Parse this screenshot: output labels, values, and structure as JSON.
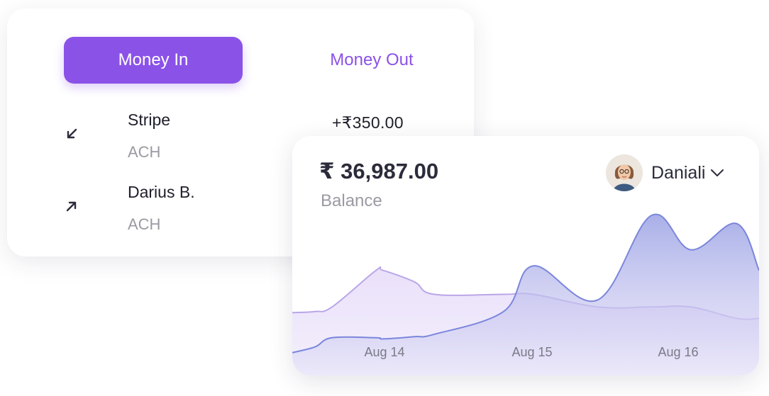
{
  "tabs": {
    "money_in": "Money In",
    "money_out": "Money Out"
  },
  "transactions": [
    {
      "name": "Stripe",
      "method": "ACH",
      "amount": "+₹350.00",
      "direction": "incoming",
      "icon": "arrow-down-left-icon"
    },
    {
      "name": "Darius B.",
      "method": "ACH",
      "direction": "outgoing",
      "icon": "arrow-up-right-icon"
    }
  ],
  "balance": {
    "amount": "₹ 36,987.00",
    "label": "Balance"
  },
  "user": {
    "name": "Daniali",
    "menu_icon": "chevron-down-icon"
  },
  "colors": {
    "accent": "#8b52e8",
    "series_light": "#b9a6e8",
    "series_dark": "#7b86dc"
  },
  "chart_data": {
    "type": "area",
    "categories": [
      "Aug 14",
      "Aug 15",
      "Aug 16"
    ],
    "series": [
      {
        "values": [
          55,
          56,
          60,
          92,
          92,
          82,
          71,
          71,
          71,
          60,
          60,
          60,
          50,
          50
        ]
      },
      {
        "values": [
          20,
          25,
          33,
          33,
          32,
          34,
          36,
          56,
          96,
          66,
          140,
          110,
          133,
          92
        ]
      }
    ]
  }
}
